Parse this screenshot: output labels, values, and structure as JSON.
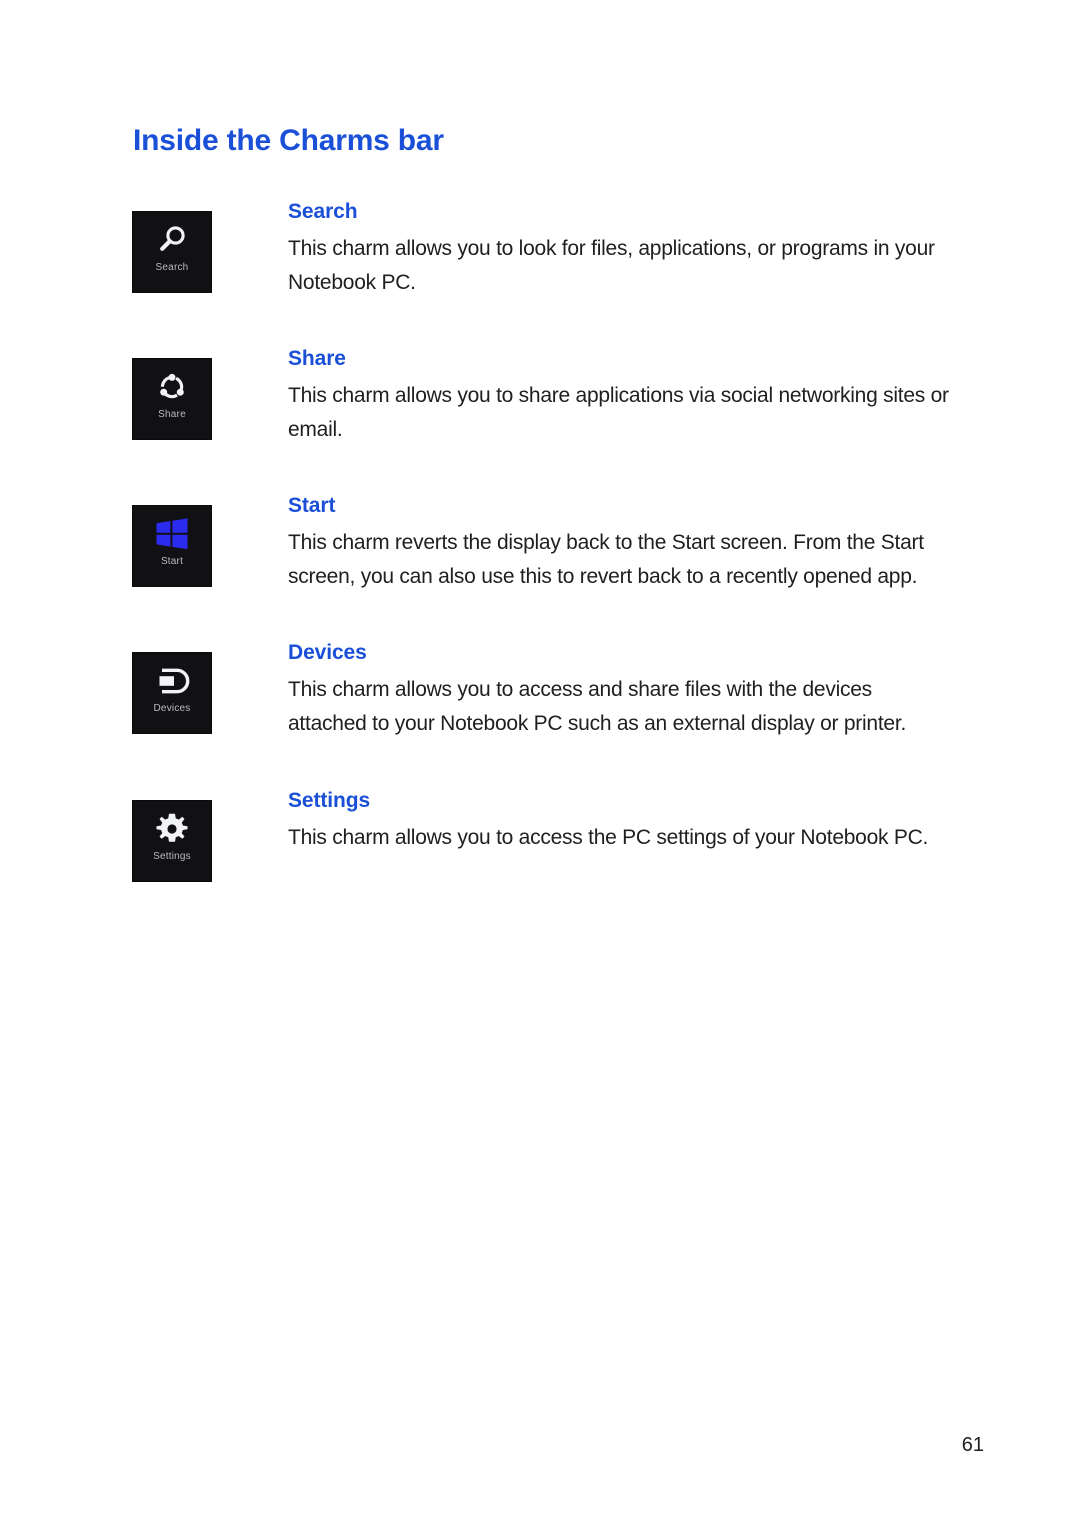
{
  "document": {
    "heading": "Inside the Charms bar",
    "page_number": "61",
    "heading_color": "#1a4fd8",
    "body_color": "#201f1e",
    "tile_background": "#111113"
  },
  "charms": [
    {
      "icon_name": "search-icon",
      "tile_label": "Search",
      "name": "Search",
      "description": "This charm allows you to look for files, applications, or programs in your Notebook PC."
    },
    {
      "icon_name": "share-icon",
      "tile_label": "Share",
      "name": "Share",
      "description": "This charm allows you to share applications via social networking sites or email."
    },
    {
      "icon_name": "windows-start-icon",
      "tile_label": "Start",
      "name": "Start",
      "description": "This charm reverts the display back to the Start screen. From the Start screen, you can also use this to revert back to a recently opened app.",
      "accent": "#2b2bf0"
    },
    {
      "icon_name": "devices-icon",
      "tile_label": "Devices",
      "name": "Devices",
      "description": "This charm allows you to access and share files with the devices attached to your Notebook PC such as an external display or printer."
    },
    {
      "icon_name": "settings-gear-icon",
      "tile_label": "Settings",
      "name": "Settings",
      "description": "This charm allows you to access the PC settings of your Notebook PC."
    }
  ]
}
